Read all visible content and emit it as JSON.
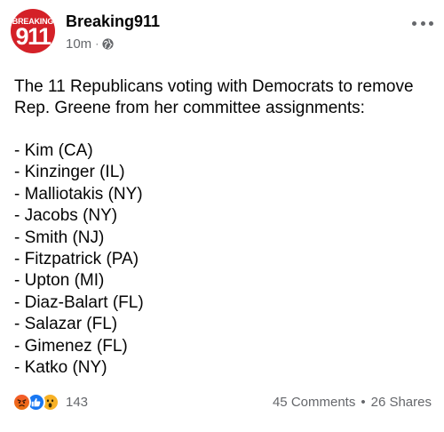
{
  "header": {
    "avatar_text_top": "BREAKING",
    "avatar_text_main": "911",
    "author": "Breaking911",
    "timestamp": "10m",
    "separator": "·",
    "privacy_icon": "globe-icon",
    "more_icon": "more-options-icon"
  },
  "post": {
    "intro": "The 11 Republicans voting with Democrats to remove Rep. Greene from her committee assignments:",
    "items": [
      "- Kim (CA)",
      "- Kinzinger (IL)",
      "- Malliotakis (NY)",
      "- Jacobs (NY)",
      "- Smith (NJ)",
      "- Fitzpatrick (PA)",
      "- Upton (MI)",
      "- Diaz-Balart (FL)",
      "- Salazar (FL)",
      "- Gimenez (FL)",
      "- Katko (NY)"
    ]
  },
  "footer": {
    "reaction_icons": [
      "angry-reaction-icon",
      "like-reaction-icon",
      "wow-reaction-icon"
    ],
    "reaction_count": "143",
    "comments": "45 Comments",
    "separator": "•",
    "shares": "26 Shares"
  },
  "colors": {
    "brand_red": "#d42128",
    "text_primary": "#050505",
    "text_secondary": "#65676b",
    "like_blue": "#1877f2",
    "angry_orange": "#f55a2c",
    "wow_yellow": "#f7b125"
  }
}
